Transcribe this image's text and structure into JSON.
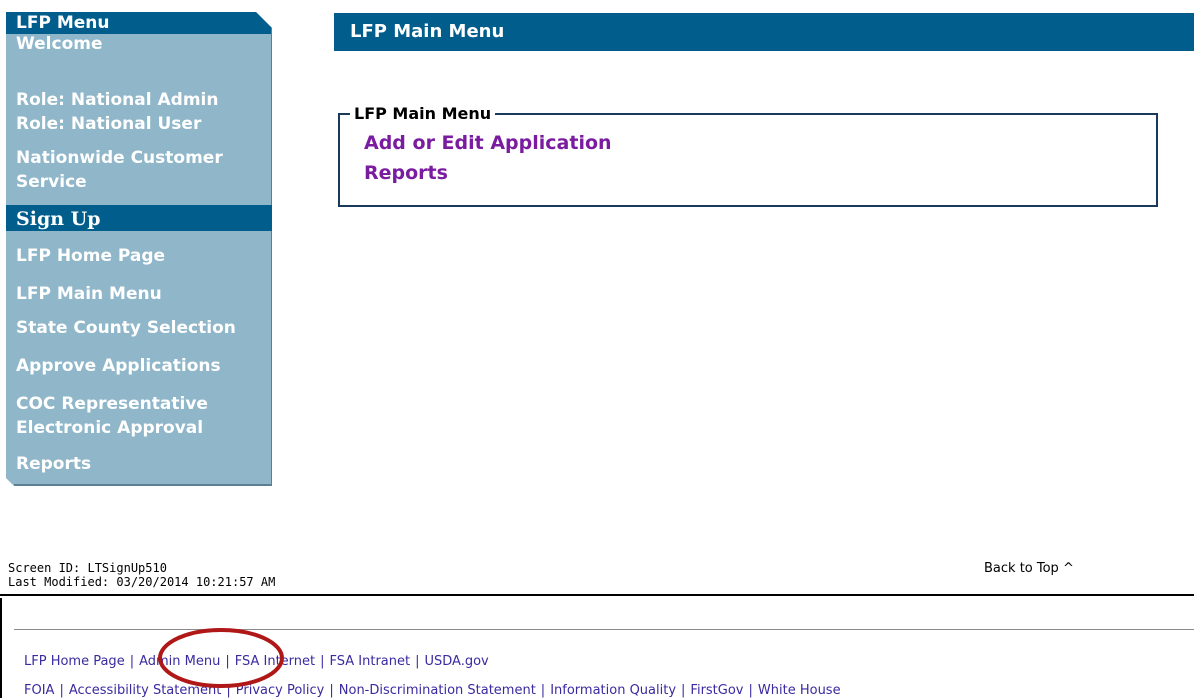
{
  "sidebar": {
    "title": "LFP Menu",
    "welcome": "Welcome",
    "role1": "Role: National Admin",
    "role2": "Role: National User",
    "ncs_line1": "Nationwide Customer",
    "ncs_line2": "Service",
    "section": "Sign Up",
    "items": {
      "home": "LFP Home Page",
      "main": "LFP Main Menu",
      "state": "State County Selection",
      "approve": "Approve Applications",
      "coc_line1": "COC Representative",
      "coc_line2": "Electronic Approval",
      "reports": "Reports"
    },
    "bg_color": "#8fb6c9",
    "bar_color": "#005d8c"
  },
  "header": {
    "title": "LFP Main Menu"
  },
  "menu_box": {
    "legend": "LFP Main Menu",
    "links": [
      "Add or Edit Application",
      "Reports"
    ]
  },
  "meta": {
    "screen_id": "Screen ID: LTSignUp510",
    "last_modified": "Last Modified: 03/20/2014 10:21:57 AM",
    "back_to_top": "Back to Top ^"
  },
  "footer": {
    "row1": [
      "LFP Home Page",
      "Admin Menu",
      "FSA Internet",
      "FSA Intranet",
      "USDA.gov"
    ],
    "row2": [
      "FOIA",
      "Accessibility Statement",
      "Privacy Policy",
      "Non-Discrimination Statement",
      "Information Quality",
      "FirstGov",
      "White House"
    ]
  },
  "colors": {
    "link_purple": "#7a1ca0",
    "footer_link": "#3a2aa0",
    "highlight": "#b01818"
  }
}
